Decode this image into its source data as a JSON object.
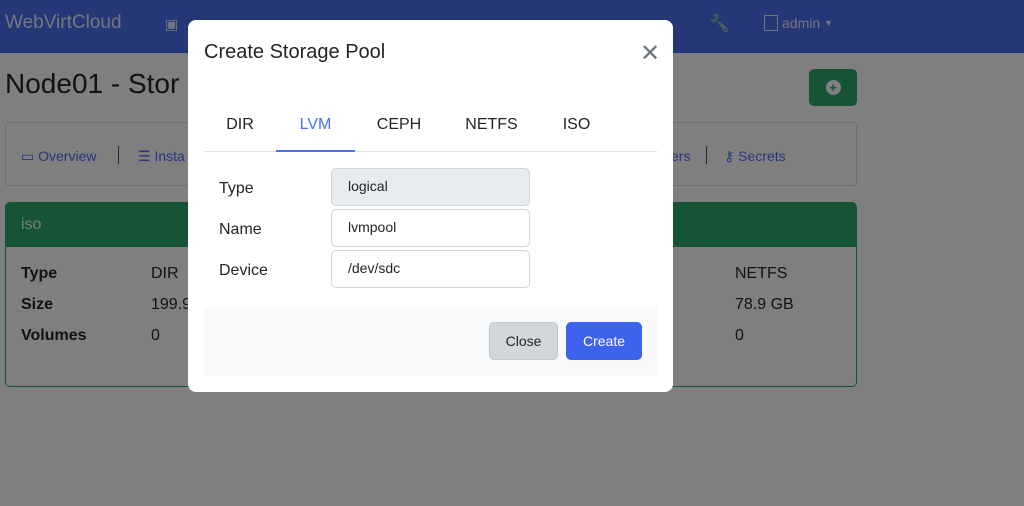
{
  "navbar": {
    "brand": "WebVirtCloud",
    "user": "admin",
    "icons": [
      "wrench-icon",
      "user-icon",
      "caret-down-icon"
    ]
  },
  "page": {
    "title_visible": "Node01 - Stor",
    "add_icon": "plus-circle-icon"
  },
  "subnav": {
    "items": [
      {
        "label": "Overview",
        "icon": "laptop-icon"
      },
      {
        "label": "Insta",
        "icon": "database-icon"
      },
      {
        "label": "ers"
      },
      {
        "label": "Secrets",
        "icon": "key-icon"
      }
    ]
  },
  "pool_card": {
    "name": "iso",
    "labels": [
      "Type",
      "Size",
      "Volumes"
    ],
    "values_left": [
      "DIR",
      "199.9",
      "0"
    ],
    "values_right": [
      "NETFS",
      "78.9 GB",
      "0"
    ]
  },
  "modal": {
    "title": "Create Storage Pool",
    "tabs": [
      {
        "label": "DIR"
      },
      {
        "label": "LVM",
        "active": true
      },
      {
        "label": "CEPH"
      },
      {
        "label": "NETFS"
      },
      {
        "label": "ISO"
      }
    ],
    "fields": [
      {
        "label": "Type",
        "value": "logical",
        "readonly": true
      },
      {
        "label": "Name",
        "value": "lvmpool"
      },
      {
        "label": "Device",
        "value": "/dev/sdc"
      }
    ],
    "close_label": "Close",
    "create_label": "Create"
  },
  "colors": {
    "primary": "#4d6ef0",
    "success": "#2fa86c"
  }
}
